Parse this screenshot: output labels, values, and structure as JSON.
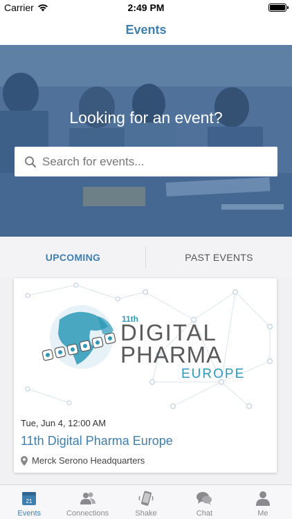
{
  "status_bar": {
    "carrier": "Carrier",
    "time": "2:49 PM"
  },
  "nav": {
    "title": "Events"
  },
  "hero": {
    "title": "Looking for an event?",
    "search_placeholder": "Search for events..."
  },
  "tabs": [
    {
      "label": "UPCOMING",
      "active": true
    },
    {
      "label": "PAST EVENTS",
      "active": false
    }
  ],
  "event": {
    "banner": {
      "edition": "11th",
      "line1": "DIGITAL",
      "line2": "PHARMA",
      "line3": "EUROPE"
    },
    "date": "Tue, Jun 4, 12:00 AM",
    "name": "11th Digital Pharma Europe",
    "location": "Merck Serono Headquarters"
  },
  "tab_bar": {
    "items": [
      {
        "label": "Events",
        "icon": "calendar-icon",
        "active": true,
        "badge": "21"
      },
      {
        "label": "Connections",
        "icon": "people-icon",
        "active": false
      },
      {
        "label": "Shake",
        "icon": "phone-shake-icon",
        "active": false
      },
      {
        "label": "Chat",
        "icon": "chat-bubbles-icon",
        "active": false
      },
      {
        "label": "Me",
        "icon": "person-icon",
        "active": false
      }
    ]
  },
  "colors": {
    "accent": "#3f7fb0",
    "hero_overlay": "#2a588c",
    "banner_teal": "#2e9ab8",
    "banner_gray": "#5a5a5a"
  }
}
